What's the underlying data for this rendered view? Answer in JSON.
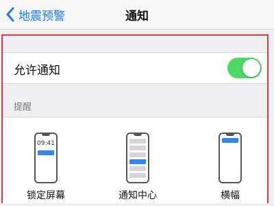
{
  "nav": {
    "back_label": "地震预警",
    "title": "通知"
  },
  "allow": {
    "label": "允许通知",
    "enabled": true
  },
  "alerts_section": {
    "header": "提醒",
    "options": [
      {
        "label": "锁定屏幕",
        "time": "09:41"
      },
      {
        "label": "通知中心"
      },
      {
        "label": "横幅"
      }
    ]
  },
  "colors": {
    "accent": "#1a7cf5",
    "toggle_on": "#4cd964",
    "highlight_border": "#e0383e",
    "notification_blue": "#2f86f6"
  }
}
